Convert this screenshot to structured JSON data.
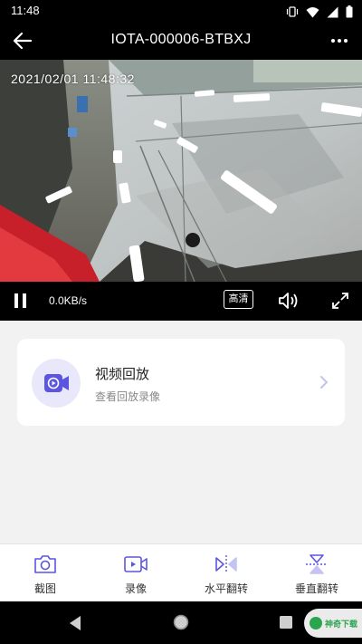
{
  "status_bar": {
    "time": "11:48",
    "icons": [
      "vibrate-icon",
      "wifi-icon",
      "signal-icon",
      "battery-icon"
    ]
  },
  "app_bar": {
    "title": "IOTA-000006-BTBXJ",
    "back_icon": "arrow-left-icon",
    "more_icon": "more-dots-icon"
  },
  "video": {
    "timestamp": "2021/02/01 11:48:32"
  },
  "controls": {
    "speed": "0.0KB/s",
    "quality": "高清"
  },
  "card": {
    "title": "视频回放",
    "subtitle": "查看回放录像",
    "icon": "video-playback-icon"
  },
  "toolbar": {
    "items": [
      {
        "label": "截图",
        "icon": "camera-icon"
      },
      {
        "label": "录像",
        "icon": "record-icon"
      },
      {
        "label": "水平翻转",
        "icon": "flip-horizontal-icon"
      },
      {
        "label": "垂直翻转",
        "icon": "flip-vertical-icon"
      }
    ]
  },
  "watermark": {
    "text": "神奇下载"
  },
  "colors": {
    "accent": "#5b55e0",
    "icon_bg": "#e9e8fb",
    "background": "#f2f2f2",
    "bar": "#000000"
  }
}
